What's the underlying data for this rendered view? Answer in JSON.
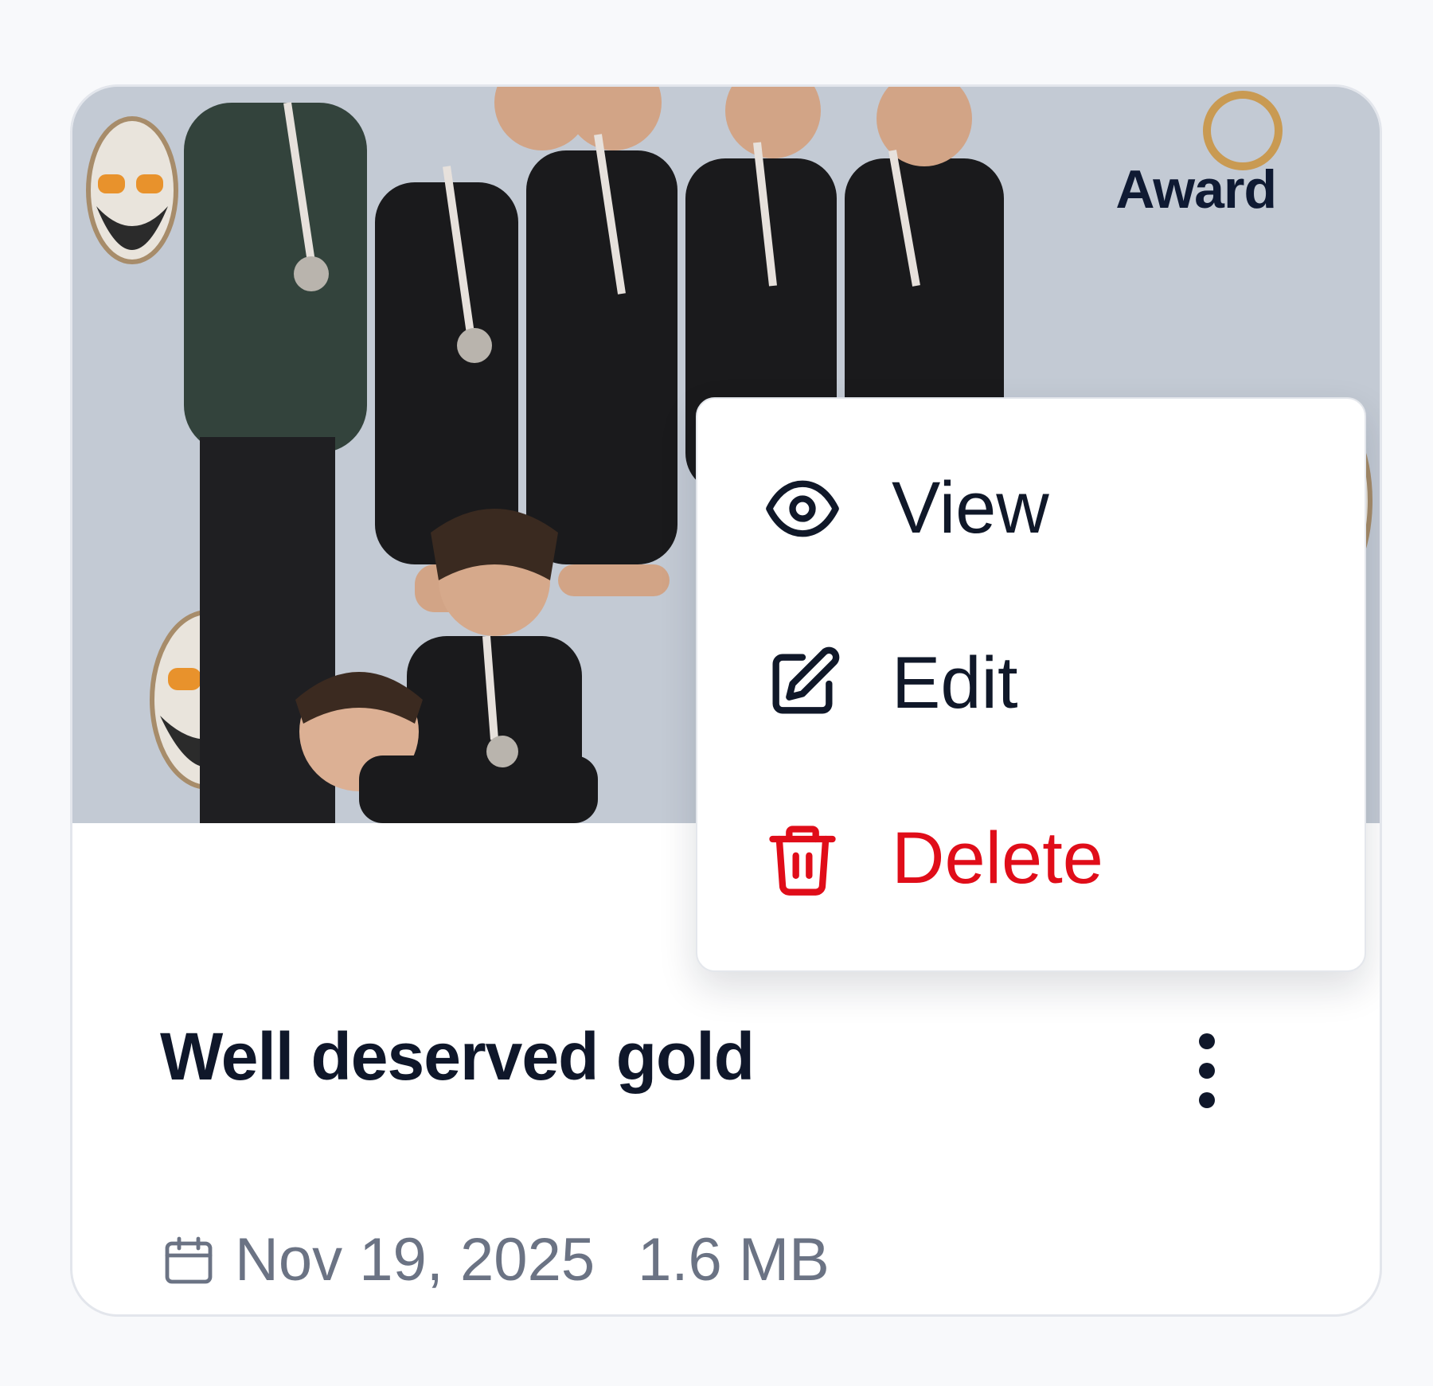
{
  "card": {
    "category": "Award",
    "title": "Well deserved gold",
    "date": "Nov 19, 2025",
    "file_size": "1.6 MB"
  },
  "menu": {
    "items": [
      {
        "label": "View",
        "icon": "eye-icon"
      },
      {
        "label": "Edit",
        "icon": "edit-icon"
      },
      {
        "label": "Delete",
        "icon": "trash-icon"
      }
    ]
  },
  "icons": {
    "calendar": "calendar-icon",
    "more": "more-vertical-icon"
  },
  "colors": {
    "title": "#0f172a",
    "meta": "#6b7384",
    "danger": "#e00d19",
    "card_border": "#e3e6ec",
    "background": "#f8f9fb"
  }
}
